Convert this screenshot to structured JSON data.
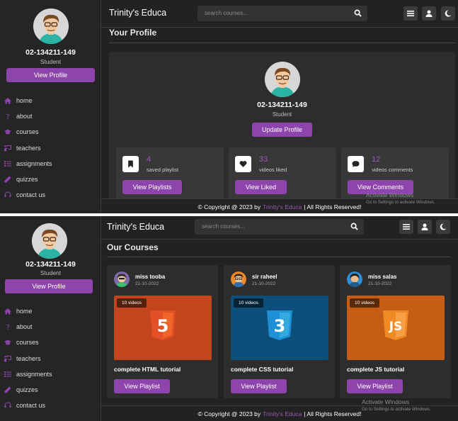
{
  "brand": "Trinity's Educa",
  "search_placeholder": "search courses...",
  "user": {
    "id": "02-134211-149",
    "role": "Student",
    "view_profile": "View Profile"
  },
  "nav": [
    "home",
    "about",
    "courses",
    "teachers",
    "assignments",
    "quizzes",
    "contact us"
  ],
  "nav_icons": [
    "home-icon",
    "question-icon",
    "graduation-cap-icon",
    "chalkboard-teacher-icon",
    "list-icon",
    "pen-icon",
    "headset-icon"
  ],
  "header_buttons": [
    "menu-icon",
    "user-icon",
    "moon-icon"
  ],
  "profile": {
    "title": "Your Profile",
    "id": "02-134211-149",
    "role": "Student",
    "update_button": "Update Profile",
    "stats": [
      {
        "icon": "bookmark-icon",
        "value": "4",
        "label": "saved playlist",
        "button": "View Playlists"
      },
      {
        "icon": "heart-icon",
        "value": "33",
        "label": "videos liked",
        "button": "View Liked"
      },
      {
        "icon": "comment-icon",
        "value": "12",
        "label": "videos comments",
        "button": "View Comments"
      }
    ]
  },
  "courses": {
    "title": "Our Courses",
    "items": [
      {
        "tutor": "miss tooba",
        "date": "21-10-2022",
        "videos": "10 videos",
        "thumb_label": "5",
        "thumb_color": "#c2451e",
        "logo_color": "#e34f26",
        "title": "complete HTML tutorial",
        "button": "View Playlist"
      },
      {
        "tutor": "sir raheel",
        "date": "21-10-2022",
        "videos": "10 videos",
        "thumb_label": "3",
        "thumb_color": "#0b4f7a",
        "logo_color": "#1f8fd6",
        "title": "complete CSS tutorial",
        "button": "View Playlist"
      },
      {
        "tutor": "miss salas",
        "date": "21-10-2022",
        "videos": "10 videos",
        "thumb_label": "JS",
        "thumb_color": "#c75d14",
        "logo_color": "#f08a24",
        "title": "complete JS tutorial",
        "button": "View Playlist"
      }
    ]
  },
  "footer": {
    "prefix": "© Copyright @ 2023 by",
    "brand": "Trinity's Educa",
    "suffix": "| All Rights Reserved!"
  },
  "watermark": {
    "line1": "Activate Windows",
    "line2": "Go to Settings to activate Windows."
  },
  "colors": {
    "accent": "#8e44ad",
    "bg": "#222222",
    "panel": "#2d2d2d"
  }
}
